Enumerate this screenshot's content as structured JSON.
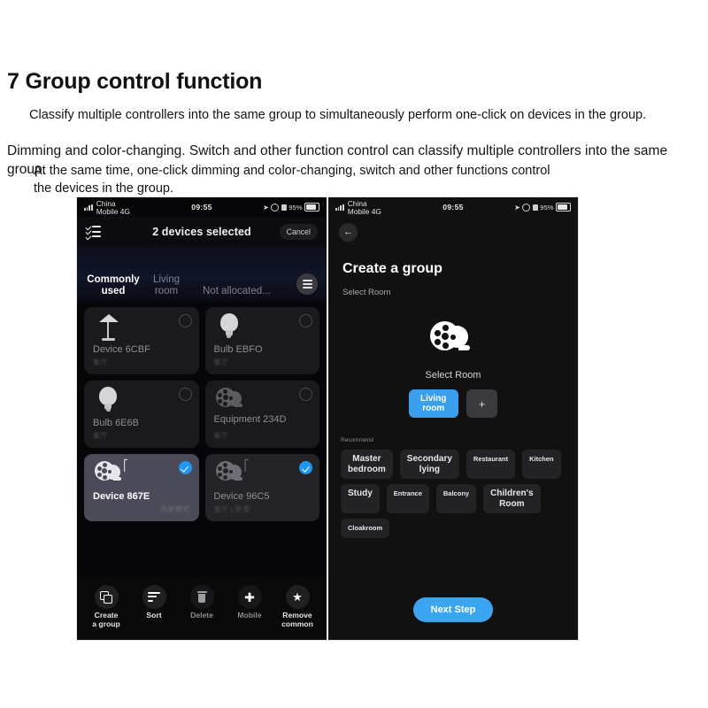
{
  "doc": {
    "title": "7 Group control function",
    "para_a": "Classify multiple controllers into the same group to simultaneously perform one-click on devices in the group.",
    "para_b": "Dimming and color-changing. Switch and other function control can classify multiple controllers into the same group.",
    "para_c": "At the same time, one-click dimming and color-changing, switch and other functions control the devices in the group."
  },
  "status_bar": {
    "carrier": "China\nMobile 4G",
    "time": "09:55",
    "battery_pct": "95%"
  },
  "left_phone": {
    "header": {
      "checklist_icon": "checklist-icon",
      "title": "2 devices selected",
      "cancel": "Cancel"
    },
    "tabs": [
      {
        "label": "Commonly\nused",
        "active": true
      },
      {
        "label": "Living\nroom",
        "active": false
      },
      {
        "label": "Not allocated...",
        "active": false
      }
    ],
    "tab_menu_icon": "hamburger-icon",
    "devices": [
      {
        "name": "Device 6CBF",
        "sub": "客厅",
        "sub2": "",
        "icon": "lamp-icon",
        "selected": false,
        "bluetooth": false
      },
      {
        "name": "Bulb EBFO",
        "sub": "客厅",
        "sub2": "",
        "icon": "bulb-icon",
        "selected": false,
        "bluetooth": false
      },
      {
        "name": "Bulb 6E6B",
        "sub": "客厅",
        "sub2": "",
        "icon": "bulb-icon",
        "selected": false,
        "bluetooth": false
      },
      {
        "name": "Equipment 234D",
        "sub": "客厅",
        "sub2": "",
        "icon": "reel-icon",
        "selected": false,
        "bluetooth": false
      },
      {
        "name": "Device 867E",
        "sub": "客厅",
        "sub2": "场景模式",
        "icon": "reel-icon",
        "selected": true,
        "bluetooth": true
      },
      {
        "name": "Device 96C5",
        "sub": "客厅 | 卧室",
        "sub2": "",
        "icon": "reel-icon",
        "selected": true,
        "bluetooth": true
      }
    ],
    "toolbar": [
      {
        "label": "Create\na group",
        "icon": "copy-icon",
        "dim": false
      },
      {
        "label": "Sort",
        "icon": "sort-icon",
        "dim": false
      },
      {
        "label": "Delete",
        "icon": "trash-icon",
        "dim": true
      },
      {
        "label": "Mobile",
        "icon": "move-icon",
        "dim": true
      },
      {
        "label": "Remove\ncommon",
        "icon": "star-icon",
        "dim": false
      }
    ]
  },
  "right_phone": {
    "back_icon": "back-arrow-icon",
    "title": "Create a group",
    "subtitle": "Select Room",
    "hero": {
      "icon": "reel-icon",
      "label": "Select Room",
      "selected_room": "Living\nroom",
      "add_label": "+"
    },
    "recommend_label": "Recommend",
    "rooms": [
      {
        "label": "Master\nbedroom",
        "small": false
      },
      {
        "label": "Secondary\nlying",
        "small": false
      },
      {
        "label": "Restaurant",
        "small": true
      },
      {
        "label": "Kitchen",
        "small": true
      },
      {
        "label": "Study",
        "small": false
      },
      {
        "label": "Entrance",
        "small": true
      },
      {
        "label": "Balcony",
        "small": true
      },
      {
        "label": "Children's\nRoom",
        "small": false
      },
      {
        "label": "Cloakroom",
        "small": true
      }
    ],
    "next_button": "Next Step"
  },
  "colors": {
    "accent_blue": "#3aa5f0",
    "check_blue": "#2196f3",
    "card_bg": "#1a1a1c",
    "card_selected_bg": "#4a4a58"
  }
}
